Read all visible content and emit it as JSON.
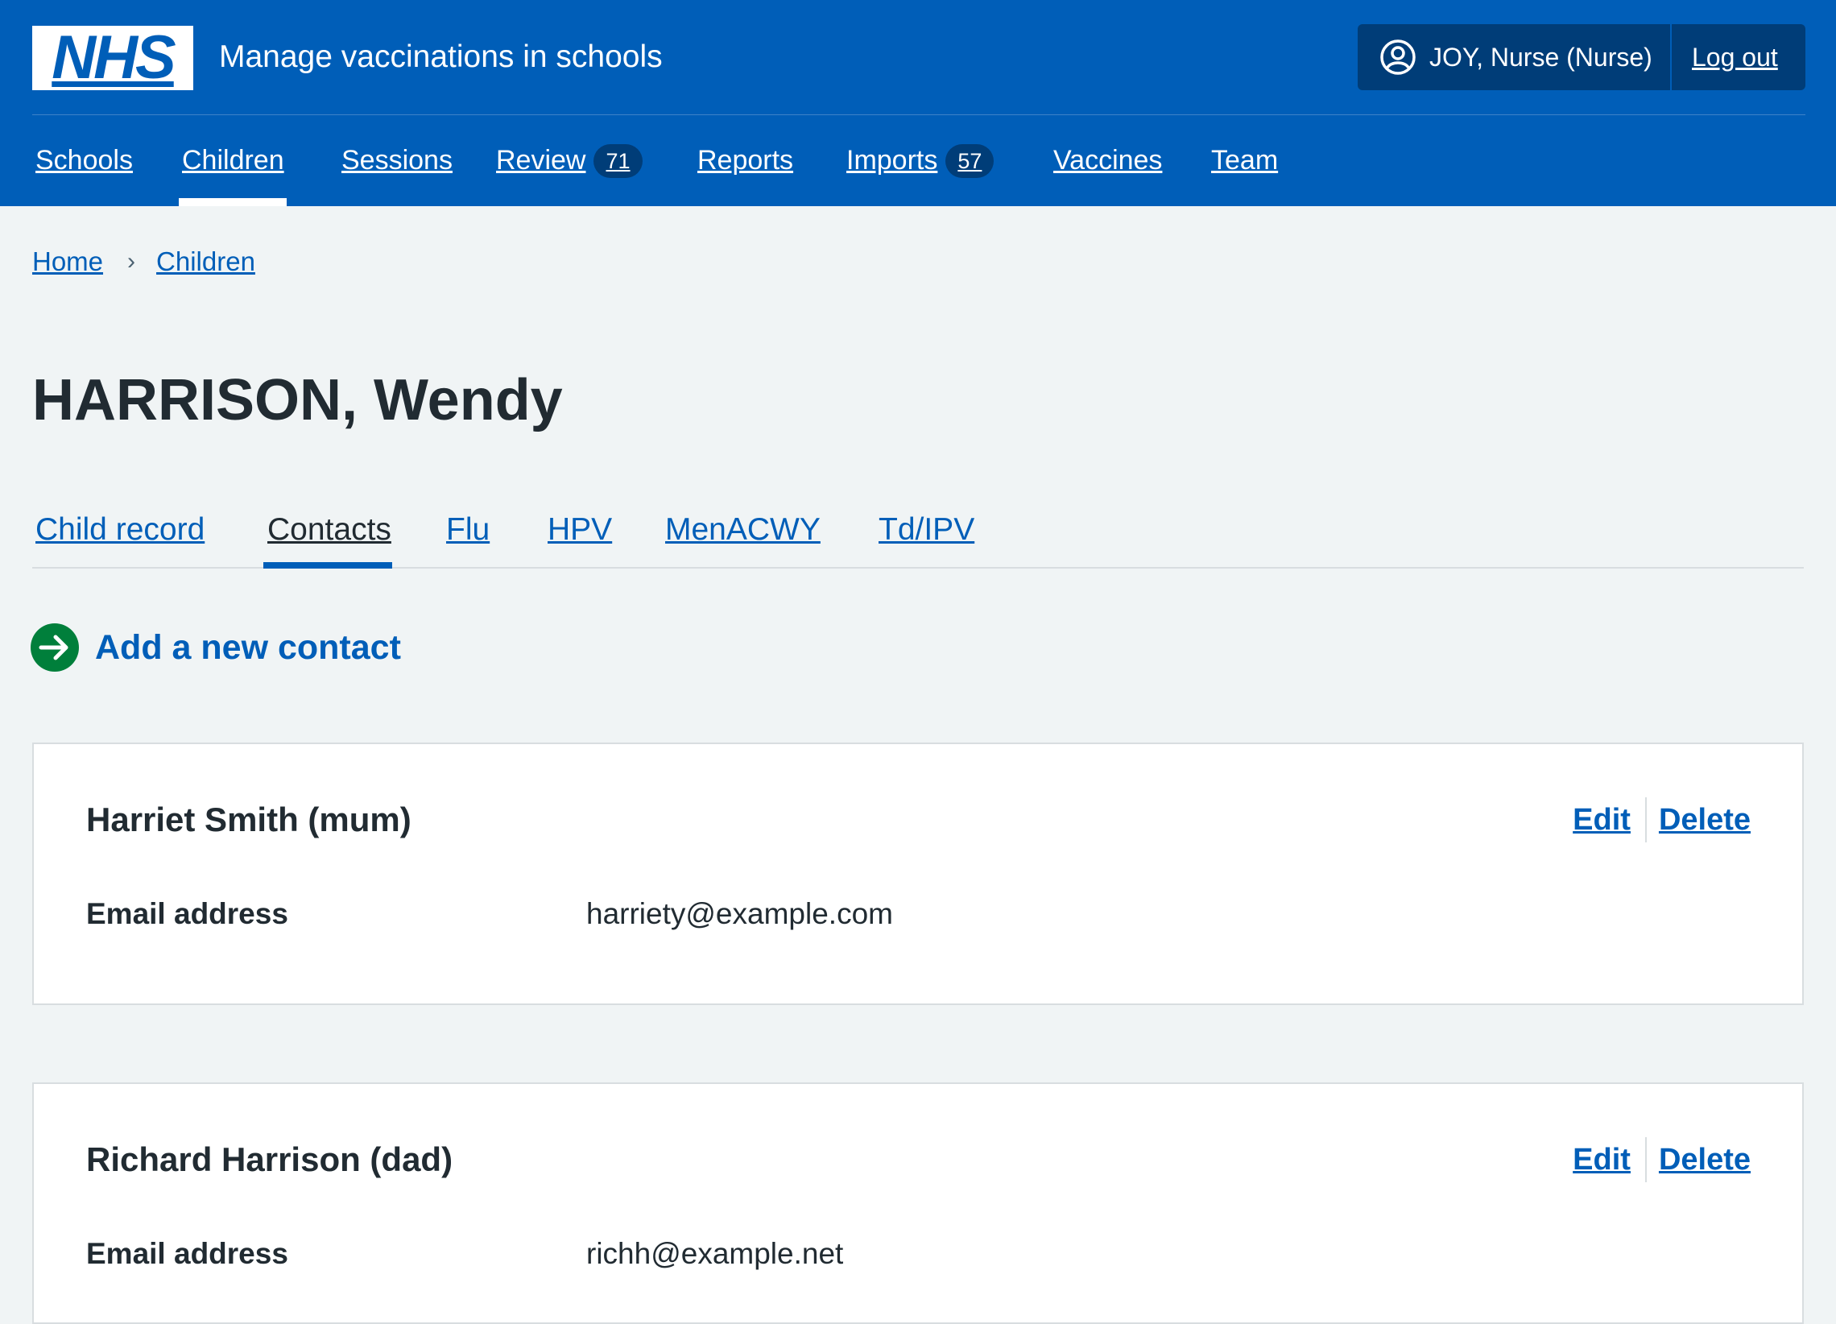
{
  "header": {
    "logo_text": "NHS",
    "service_name": "Manage vaccinations in schools",
    "account_user": "JOY, Nurse (Nurse)",
    "logout_label": "Log out",
    "brand_color": "#005eb8",
    "account_bg": "#003d78"
  },
  "nav": {
    "items": [
      {
        "label": "Schools"
      },
      {
        "label": "Children",
        "active": true
      },
      {
        "label": "Sessions"
      },
      {
        "label": "Review",
        "count": "71"
      },
      {
        "label": "Reports"
      },
      {
        "label": "Imports",
        "count": "57"
      },
      {
        "label": "Vaccines"
      },
      {
        "label": "Team"
      }
    ]
  },
  "breadcrumb": [
    "Home",
    "Children"
  ],
  "page_title": "HARRISON, Wendy",
  "tabs": [
    {
      "label": "Child record"
    },
    {
      "label": "Contacts",
      "active": true
    },
    {
      "label": "Flu"
    },
    {
      "label": "HPV"
    },
    {
      "label": "MenACWY"
    },
    {
      "label": "Td/IPV"
    }
  ],
  "action_link": {
    "label": "Add a new contact",
    "icon": "arrow-right-circle-icon",
    "icon_color": "#007f3b"
  },
  "contacts": [
    {
      "name": "Harriet Smith (mum)",
      "edit_label": "Edit",
      "delete_label": "Delete",
      "email_key": "Email address",
      "email_value": "harriety@example.com"
    },
    {
      "name": "Richard Harrison (dad)",
      "edit_label": "Edit",
      "delete_label": "Delete",
      "email_key": "Email address",
      "email_value": "richh@example.net"
    }
  ]
}
